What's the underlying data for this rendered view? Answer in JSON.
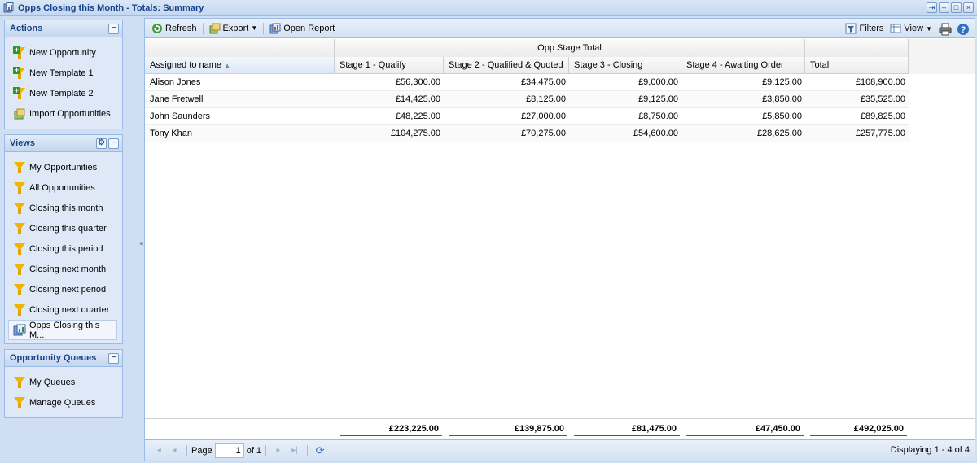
{
  "window": {
    "title": "Opps Closing this Month - Totals: Summary",
    "controls": [
      "restore",
      "minimize",
      "maximize",
      "close"
    ]
  },
  "actions": {
    "title": "Actions",
    "items": [
      {
        "label": "New Opportunity",
        "icon": "new-opportunity-icon"
      },
      {
        "label": "New Template 1",
        "icon": "new-template-icon"
      },
      {
        "label": "New Template 2",
        "icon": "new-template-icon"
      },
      {
        "label": "Import Opportunities",
        "icon": "import-icon"
      }
    ]
  },
  "views": {
    "title": "Views",
    "items": [
      {
        "label": "My Opportunities",
        "icon": "funnel-icon"
      },
      {
        "label": "All Opportunities",
        "icon": "funnel-icon"
      },
      {
        "label": "Closing this month",
        "icon": "funnel-icon"
      },
      {
        "label": "Closing this quarter",
        "icon": "funnel-icon"
      },
      {
        "label": "Closing this period",
        "icon": "funnel-icon"
      },
      {
        "label": "Closing next month",
        "icon": "funnel-icon"
      },
      {
        "label": "Closing next period",
        "icon": "funnel-icon"
      },
      {
        "label": "Closing next quarter",
        "icon": "funnel-icon"
      },
      {
        "label": "Opps Closing this M...",
        "icon": "report-icon",
        "selected": true
      }
    ]
  },
  "queues": {
    "title": "Opportunity Queues",
    "items": [
      {
        "label": "My Queues",
        "icon": "funnel-icon"
      },
      {
        "label": "Manage Queues",
        "icon": "funnel-icon"
      }
    ]
  },
  "toolbar": {
    "refresh": "Refresh",
    "export": "Export",
    "open_report": "Open Report",
    "filters": "Filters",
    "view": "View"
  },
  "grid": {
    "group_header": "Opp Stage Total",
    "columns": [
      "Assigned to name",
      "Stage 1 - Qualify",
      "Stage 2 - Qualified & Quoted",
      "Stage 3 - Closing",
      "Stage 4 - Awaiting Order",
      "Total"
    ],
    "rows": [
      [
        "Alison Jones",
        "£56,300.00",
        "£34,475.00",
        "£9,000.00",
        "£9,125.00",
        "£108,900.00"
      ],
      [
        "Jane Fretwell",
        "£14,425.00",
        "£8,125.00",
        "£9,125.00",
        "£3,850.00",
        "£35,525.00"
      ],
      [
        "John Saunders",
        "£48,225.00",
        "£27,000.00",
        "£8,750.00",
        "£5,850.00",
        "£89,825.00"
      ],
      [
        "Tony Khan",
        "£104,275.00",
        "£70,275.00",
        "£54,600.00",
        "£28,625.00",
        "£257,775.00"
      ]
    ],
    "totals": [
      "£223,225.00",
      "£139,875.00",
      "£81,475.00",
      "£47,450.00",
      "£492,025.00"
    ]
  },
  "pager": {
    "page_label": "Page",
    "page_value": "1",
    "of_label": "of 1",
    "display_info": "Displaying 1 - 4 of 4"
  }
}
